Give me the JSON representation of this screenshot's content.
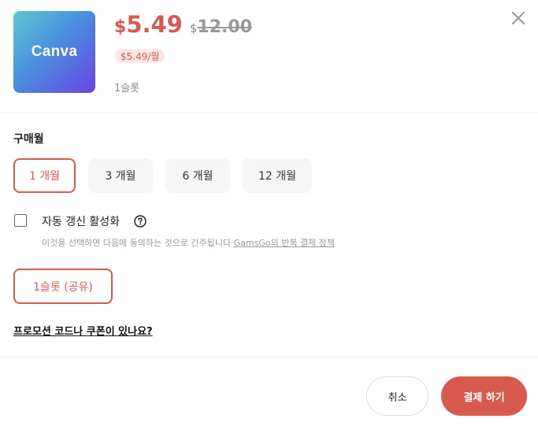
{
  "product": {
    "logo_text": "Canva",
    "currency_symbol": "$",
    "price": "5.49",
    "original_currency_symbol": "$",
    "original_price": "12.00",
    "monthly_badge": "$5.49/월",
    "slots": "1슬롯"
  },
  "purchase": {
    "section_title": "구매월",
    "month_options": [
      {
        "label": "1 개월",
        "selected": true
      },
      {
        "label": "3 개월",
        "selected": false
      },
      {
        "label": "6 개월",
        "selected": false
      },
      {
        "label": "12 개월",
        "selected": false
      }
    ]
  },
  "auto_renew": {
    "label": "자동 갱신 활성화",
    "checked": false,
    "consent_prefix": "이것을 선택하면 다음에 동의하는 것으로 간주됩니다 ",
    "consent_link": "GamsGo의 반복 결제 정책"
  },
  "slot_option": {
    "label": "1슬롯 (공유)",
    "selected": true
  },
  "promo_link": "프로모션 코드나 쿠폰이 있나요?",
  "actions": {
    "cancel": "취소",
    "pay": "결제 하기"
  },
  "colors": {
    "accent": "#d85a4f",
    "accent_light": "#fde6e4",
    "muted": "#999999"
  },
  "icons": {
    "close": "close-icon",
    "help": "question-circle-icon"
  }
}
